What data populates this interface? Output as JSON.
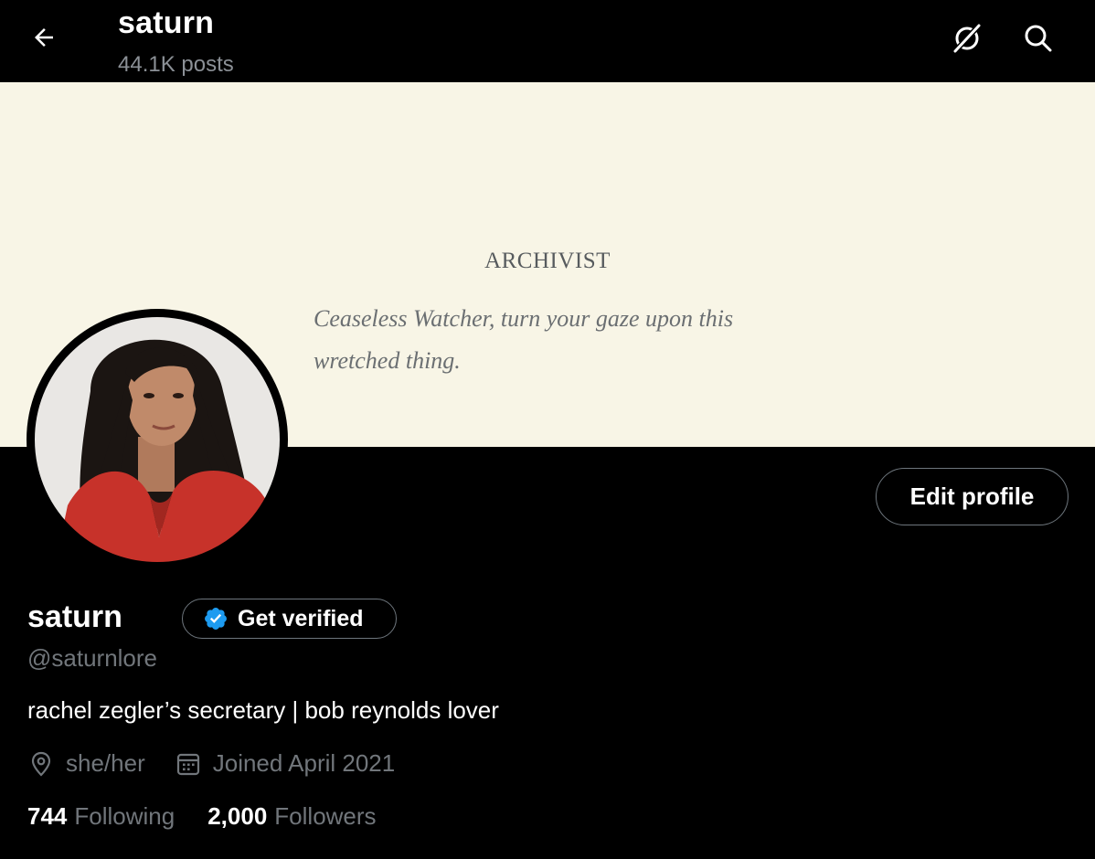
{
  "header": {
    "title": "saturn",
    "post_count": "44.1K posts"
  },
  "banner": {
    "heading": "ARCHIVIST",
    "quote": "Ceaseless Watcher, turn your gaze upon this wretched thing.",
    "background_color": "#f8f5e6"
  },
  "profile": {
    "edit_label": "Edit profile",
    "display_name": "saturn",
    "verify_label": "Get verified",
    "handle": "@saturnlore",
    "bio": "rachel zegler’s secretary | bob reynolds lover",
    "pronouns": "she/her",
    "joined": "Joined April 2021",
    "following_count": "744",
    "following_label": "Following",
    "followers_count": "2,000",
    "followers_label": "Followers"
  },
  "icons": {
    "back": "arrow-left-icon",
    "grok": "grok-icon",
    "search": "search-icon",
    "verified": "verified-badge-icon",
    "location": "location-pin-icon",
    "calendar": "calendar-icon"
  },
  "colors": {
    "accent": "#1d9bf0",
    "muted": "#71767b",
    "background": "#000000"
  }
}
